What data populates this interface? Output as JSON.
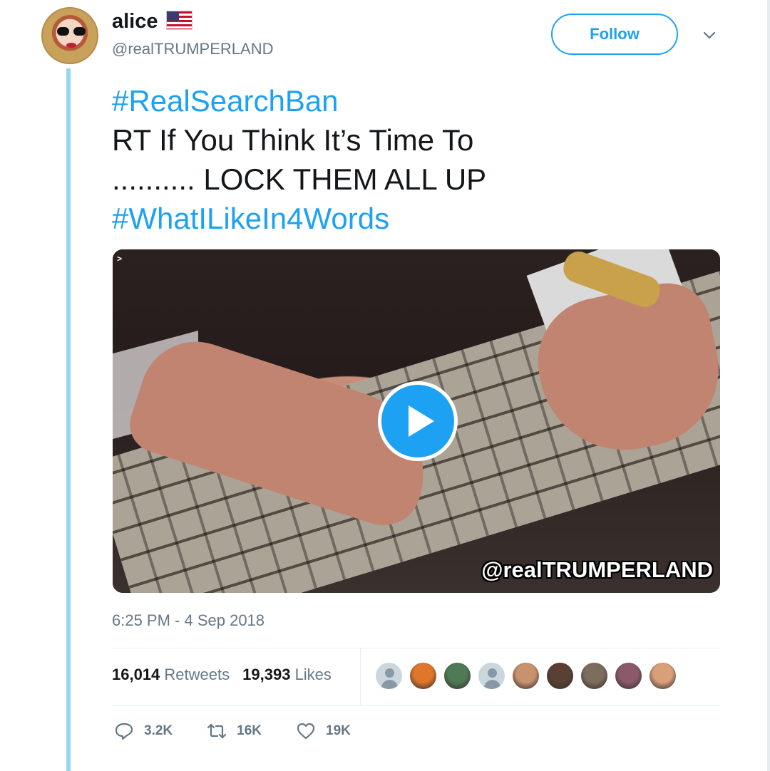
{
  "author": {
    "name": "alice",
    "handle": "@realTRUMPERLAND",
    "flag_icon": "us-flag-icon"
  },
  "follow_label": "Follow",
  "tweet": {
    "hashtag1": "#RealSearchBan",
    "line2": "RT If You Think It’s Time To",
    "line3": ".......... LOCK THEM ALL UP",
    "hashtag2": "#WhatILikeIn4Words"
  },
  "media": {
    "gif_badge": ">",
    "watermark": "@realTRUMPERLAND",
    "play_icon": "play-icon"
  },
  "timestamp": "6:25 PM - 4 Sep 2018",
  "stats": {
    "retweets_count": "16,014",
    "retweets_label": "Retweets",
    "likes_count": "19,393",
    "likes_label": "Likes"
  },
  "likers": [
    {
      "type": "default",
      "color": "#ccd6dd"
    },
    {
      "type": "photo",
      "color": "#e0762a"
    },
    {
      "type": "photo",
      "color": "#4e7a55"
    },
    {
      "type": "default",
      "color": "#ccd6dd"
    },
    {
      "type": "photo",
      "color": "#c9926e"
    },
    {
      "type": "photo",
      "color": "#5a4032"
    },
    {
      "type": "photo",
      "color": "#7d6d5c"
    },
    {
      "type": "photo",
      "color": "#8a5a6a"
    },
    {
      "type": "photo",
      "color": "#d8a07a"
    }
  ],
  "actions": {
    "reply_count": "3.2K",
    "retweet_count": "16K",
    "like_count": "19K"
  },
  "colors": {
    "accent": "#1da1f2",
    "thread_line": "#9ad5f4",
    "muted": "#657786"
  }
}
